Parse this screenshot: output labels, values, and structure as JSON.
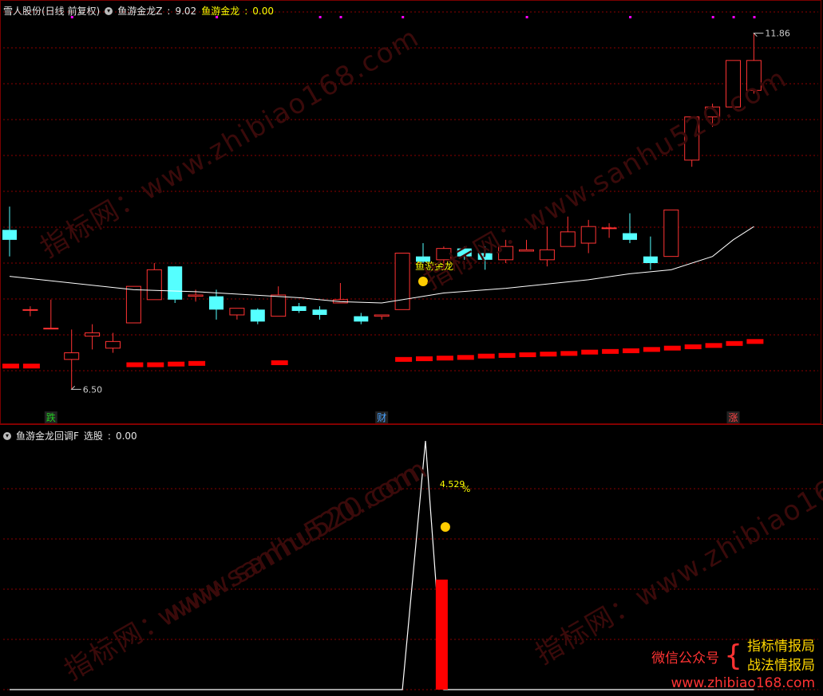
{
  "top": {
    "stock_name": "雪人股份(日线 前复权)",
    "indicator_name": "鱼游金龙Z",
    "indicator_value": "9.02",
    "series_label": "鱼游金龙",
    "series_value": "0.00",
    "max_label": "11.86",
    "min_label": "6.50",
    "signal_text": "鱼游金龙",
    "event_tags": [
      {
        "text": "跌",
        "color": "#22cc22"
      },
      {
        "text": "财",
        "color": "#4aa3ff"
      },
      {
        "text": "涨",
        "color": "#ff4444"
      }
    ]
  },
  "bottom": {
    "indicator_name": "鱼游金龙回调F",
    "output_label": "选股",
    "output_value": "0.00",
    "pct_label": "4.529",
    "pct_unit": "%"
  },
  "watermarks": [
    "指标网：www.zhibiao168.com",
    "指标网：www.sanhu520.com",
    "www.sanhu520.com",
    "指标网：www.zhibiao168.com",
    "指标网：www.sanhu520.com"
  ],
  "promo": {
    "wechat": "微信公众号",
    "name1": "指标情报局",
    "name2": "战法情报局",
    "url": "www.zhibiao168.com"
  },
  "colors": {
    "up": "#ff3333",
    "down": "#55ffff",
    "grid": "#8b0000",
    "ma": "#ffffff",
    "bar": "#ff0000",
    "dot": "#ff00ff"
  },
  "chart_data": [
    {
      "type": "candlestick",
      "title": "雪人股份(日线 前复权)",
      "ylim": [
        6.3,
        12.0
      ],
      "candles": [
        {
          "o": 8.9,
          "h": 9.25,
          "l": 8.5,
          "c": 8.75
        },
        {
          "o": 7.7,
          "h": 7.75,
          "l": 7.6,
          "c": 7.7
        },
        {
          "o": 7.42,
          "h": 7.85,
          "l": 7.42,
          "c": 7.42
        },
        {
          "o": 6.95,
          "h": 7.4,
          "l": 6.5,
          "c": 7.05
        },
        {
          "o": 7.3,
          "h": 7.48,
          "l": 7.1,
          "c": 7.35
        },
        {
          "o": 7.12,
          "h": 7.35,
          "l": 7.05,
          "c": 7.22
        },
        {
          "o": 7.5,
          "h": 8.05,
          "l": 7.5,
          "c": 8.05
        },
        {
          "o": 7.85,
          "h": 8.4,
          "l": 7.85,
          "c": 8.3
        },
        {
          "o": 8.35,
          "h": 8.35,
          "l": 7.8,
          "c": 7.85
        },
        {
          "o": 7.9,
          "h": 8.0,
          "l": 7.82,
          "c": 7.92
        },
        {
          "o": 7.9,
          "h": 8.0,
          "l": 7.55,
          "c": 7.7
        },
        {
          "o": 7.62,
          "h": 7.72,
          "l": 7.55,
          "c": 7.72
        },
        {
          "o": 7.7,
          "h": 7.72,
          "l": 7.48,
          "c": 7.52
        },
        {
          "o": 7.6,
          "h": 8.05,
          "l": 7.6,
          "c": 7.92
        },
        {
          "o": 7.75,
          "h": 7.8,
          "l": 7.65,
          "c": 7.68
        },
        {
          "o": 7.7,
          "h": 7.75,
          "l": 7.55,
          "c": 7.62
        },
        {
          "o": 7.8,
          "h": 8.1,
          "l": 7.8,
          "c": 7.85
        },
        {
          "o": 7.6,
          "h": 7.65,
          "l": 7.48,
          "c": 7.52
        },
        {
          "o": 7.6,
          "h": 7.6,
          "l": 7.55,
          "c": 7.62
        },
        {
          "o": 7.7,
          "h": 8.55,
          "l": 7.7,
          "c": 8.55
        },
        {
          "o": 8.5,
          "h": 8.7,
          "l": 8.4,
          "c": 8.42
        },
        {
          "o": 8.45,
          "h": 8.65,
          "l": 8.3,
          "c": 8.62
        },
        {
          "o": 8.62,
          "h": 8.65,
          "l": 8.45,
          "c": 8.5
        },
        {
          "o": 8.55,
          "h": 8.65,
          "l": 8.3,
          "c": 8.45
        },
        {
          "o": 8.45,
          "h": 8.75,
          "l": 8.4,
          "c": 8.65
        },
        {
          "o": 8.58,
          "h": 8.75,
          "l": 8.58,
          "c": 8.6
        },
        {
          "o": 8.45,
          "h": 8.95,
          "l": 8.35,
          "c": 8.6
        },
        {
          "o": 8.65,
          "h": 9.1,
          "l": 8.65,
          "c": 8.87
        },
        {
          "o": 8.7,
          "h": 9.05,
          "l": 8.55,
          "c": 8.95
        },
        {
          "o": 8.93,
          "h": 9.0,
          "l": 8.78,
          "c": 8.93
        },
        {
          "o": 8.85,
          "h": 9.15,
          "l": 8.7,
          "c": 8.75
        },
        {
          "o": 8.5,
          "h": 8.8,
          "l": 8.3,
          "c": 8.4
        },
        {
          "o": 8.5,
          "h": 9.2,
          "l": 8.5,
          "c": 9.2
        },
        {
          "o": 9.95,
          "h": 10.5,
          "l": 9.85,
          "c": 10.6
        },
        {
          "o": 10.6,
          "h": 10.8,
          "l": 10.45,
          "c": 10.75
        },
        {
          "o": 10.75,
          "h": 11.4,
          "l": 10.75,
          "c": 11.45
        },
        {
          "o": 11.0,
          "h": 11.86,
          "l": 10.95,
          "c": 11.45
        }
      ],
      "ma": [
        8.2,
        null,
        null,
        null,
        null,
        null,
        8.0,
        null,
        null,
        7.97,
        null,
        null,
        null,
        null,
        7.88,
        null,
        7.82,
        null,
        7.8,
        7.85,
        null,
        7.95,
        null,
        null,
        8.02,
        null,
        null,
        null,
        8.15,
        null,
        8.24,
        8.27,
        8.3,
        null,
        8.5,
        8.75,
        8.95
      ],
      "bottom_bars": [
        6.85,
        6.85,
        null,
        null,
        null,
        null,
        6.87,
        6.87,
        6.88,
        6.89,
        null,
        null,
        null,
        6.9,
        null,
        null,
        null,
        null,
        null,
        6.95,
        6.96,
        6.97,
        6.98,
        7.0,
        7.01,
        7.02,
        7.03,
        7.04,
        7.06,
        7.07,
        7.08,
        7.1,
        7.12,
        7.14,
        7.16,
        7.19,
        7.22
      ]
    },
    {
      "type": "line",
      "title": "鱼游金龙回调F",
      "series": [
        {
          "name": "选股",
          "values": [
            0,
            0,
            0,
            0,
            0,
            0,
            0,
            0,
            0,
            0,
            0,
            0,
            0,
            0,
            0,
            0,
            0,
            0,
            0,
            0,
            1,
            0,
            0,
            0,
            0,
            0,
            0,
            0,
            0,
            0,
            0,
            0,
            0,
            0,
            0,
            0,
            0
          ]
        }
      ],
      "bar": {
        "index": 21,
        "value": 0.5
      }
    }
  ]
}
